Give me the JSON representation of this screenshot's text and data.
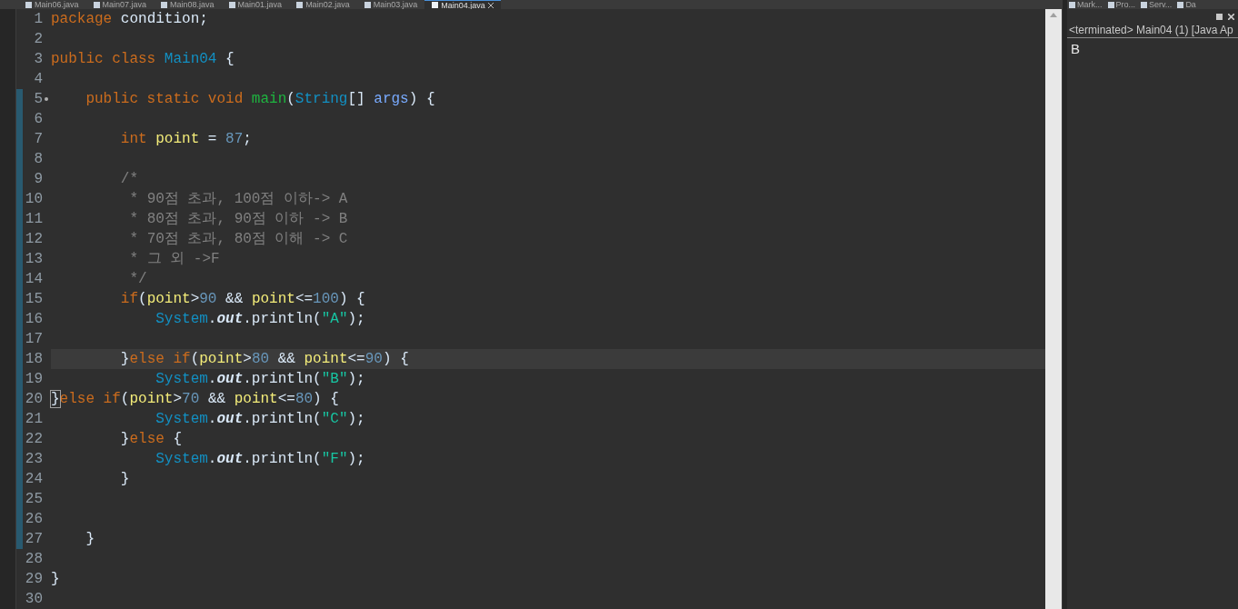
{
  "editor_tabs": [
    {
      "label": "Main06.java",
      "selected": false
    },
    {
      "label": "Main07.java",
      "selected": false
    },
    {
      "label": "Main08.java",
      "selected": false
    },
    {
      "label": "Main01.java",
      "selected": false
    },
    {
      "label": "Main02.java",
      "selected": false
    },
    {
      "label": "Main03.java",
      "selected": false
    },
    {
      "label": "Main04.java",
      "selected": true
    }
  ],
  "lines": [
    {
      "number": "1",
      "scope": false,
      "current": false,
      "fold": false,
      "tokens": [
        {
          "kind": "keyword",
          "text": "package"
        },
        {
          "kind": "plain",
          "text": " condition;"
        }
      ]
    },
    {
      "number": "2",
      "scope": false,
      "current": false,
      "fold": false
    },
    {
      "number": "3",
      "scope": false,
      "current": false,
      "fold": false,
      "tokens": [
        {
          "kind": "keyword",
          "text": "public class"
        },
        {
          "kind": "type",
          "text": " Main04"
        },
        {
          "kind": "plain",
          "text": " {"
        }
      ]
    },
    {
      "number": "4",
      "scope": false,
      "current": false,
      "fold": false
    },
    {
      "number": "5",
      "scope": true,
      "current": false,
      "fold": true,
      "tokens": [
        {
          "kind": "keyword",
          "text": "    public static void"
        },
        {
          "kind": "method",
          "text": " main"
        },
        {
          "kind": "plain",
          "text": "("
        },
        {
          "kind": "type",
          "text": "String"
        },
        {
          "kind": "plain",
          "text": "[]"
        },
        {
          "kind": "param",
          "text": " args"
        },
        {
          "kind": "plain",
          "text": ") {"
        }
      ]
    },
    {
      "number": "6",
      "scope": true,
      "current": false,
      "fold": false
    },
    {
      "number": "7",
      "scope": true,
      "current": false,
      "fold": false,
      "tokens": [
        {
          "kind": "keyword",
          "text": "        int"
        },
        {
          "kind": "local",
          "text": " point"
        },
        {
          "kind": "plain",
          "text": " ="
        },
        {
          "kind": "number",
          "text": " 87"
        },
        {
          "kind": "plain",
          "text": ";"
        }
      ]
    },
    {
      "number": "8",
      "scope": true,
      "current": false,
      "fold": false
    },
    {
      "number": "9",
      "scope": true,
      "current": false,
      "fold": false,
      "tokens": [
        {
          "kind": "comment",
          "text": "        /*"
        }
      ]
    },
    {
      "number": "10",
      "scope": true,
      "current": false,
      "fold": false,
      "tokens": [
        {
          "kind": "comment",
          "text": "         * 90점 초과, 100점 이하-> A"
        }
      ]
    },
    {
      "number": "11",
      "scope": true,
      "current": false,
      "fold": false,
      "tokens": [
        {
          "kind": "comment",
          "text": "         * 80점 초과, 90점 이하 -> B"
        }
      ]
    },
    {
      "number": "12",
      "scope": true,
      "current": false,
      "fold": false,
      "tokens": [
        {
          "kind": "comment",
          "text": "         * 70점 초과, 80점 이해 -> C"
        }
      ]
    },
    {
      "number": "13",
      "scope": true,
      "current": false,
      "fold": false,
      "tokens": [
        {
          "kind": "comment",
          "text": "         * 그 외 ->F"
        }
      ]
    },
    {
      "number": "14",
      "scope": true,
      "current": false,
      "fold": false,
      "tokens": [
        {
          "kind": "comment",
          "text": "         */"
        }
      ]
    },
    {
      "number": "15",
      "scope": true,
      "current": false,
      "fold": false,
      "tokens": [
        {
          "kind": "keyword",
          "text": "        if"
        },
        {
          "kind": "plain",
          "text": "("
        },
        {
          "kind": "local",
          "text": "point"
        },
        {
          "kind": "plain",
          "text": ">"
        },
        {
          "kind": "number",
          "text": "90"
        },
        {
          "kind": "plain",
          "text": " &&"
        },
        {
          "kind": "local",
          "text": " point"
        },
        {
          "kind": "plain",
          "text": "<="
        },
        {
          "kind": "number",
          "text": "100"
        },
        {
          "kind": "plain",
          "text": ") {"
        }
      ]
    },
    {
      "number": "16",
      "scope": true,
      "current": false,
      "fold": false,
      "tokens": [
        {
          "kind": "type",
          "text": "            System"
        },
        {
          "kind": "plain",
          "text": "."
        },
        {
          "kind": "static",
          "text": "out"
        },
        {
          "kind": "plain",
          "text": ".println("
        },
        {
          "kind": "string",
          "text": "\"A\""
        },
        {
          "kind": "plain",
          "text": ");"
        }
      ]
    },
    {
      "number": "17",
      "scope": true,
      "current": false,
      "fold": false
    },
    {
      "number": "18",
      "scope": true,
      "current": true,
      "fold": false,
      "tokens": [
        {
          "kind": "plain",
          "text": "        }"
        },
        {
          "kind": "keyword",
          "text": "else if"
        },
        {
          "kind": "plain",
          "text": "("
        },
        {
          "kind": "local",
          "text": "point"
        },
        {
          "kind": "plain",
          "text": ">"
        },
        {
          "kind": "number",
          "text": "80"
        },
        {
          "kind": "plain",
          "text": " &&"
        },
        {
          "kind": "local",
          "text": " point"
        },
        {
          "kind": "plain",
          "text": "<="
        },
        {
          "kind": "number",
          "text": "90"
        },
        {
          "kind": "plain",
          "text": ") {"
        }
      ]
    },
    {
      "number": "19",
      "scope": true,
      "current": false,
      "fold": false,
      "tokens": [
        {
          "kind": "type",
          "text": "            System"
        },
        {
          "kind": "plain",
          "text": "."
        },
        {
          "kind": "static",
          "text": "out"
        },
        {
          "kind": "plain",
          "text": ".println("
        },
        {
          "kind": "string",
          "text": "\"B\""
        },
        {
          "kind": "plain",
          "text": ");"
        }
      ]
    },
    {
      "number": "20",
      "scope": true,
      "current": false,
      "fold": false,
      "tokens": [
        {
          "kind": "bracket_match",
          "text": "}"
        },
        {
          "kind": "keyword",
          "text": "else if"
        },
        {
          "kind": "plain",
          "text": "("
        },
        {
          "kind": "local",
          "text": "point"
        },
        {
          "kind": "plain",
          "text": ">"
        },
        {
          "kind": "number",
          "text": "70"
        },
        {
          "kind": "plain",
          "text": " &&"
        },
        {
          "kind": "local",
          "text": " point"
        },
        {
          "kind": "plain",
          "text": "<="
        },
        {
          "kind": "number",
          "text": "80"
        },
        {
          "kind": "plain",
          "text": ") {"
        }
      ]
    },
    {
      "number": "21",
      "scope": true,
      "current": false,
      "fold": false,
      "tokens": [
        {
          "kind": "type",
          "text": "            System"
        },
        {
          "kind": "plain",
          "text": "."
        },
        {
          "kind": "static",
          "text": "out"
        },
        {
          "kind": "plain",
          "text": ".println("
        },
        {
          "kind": "string",
          "text": "\"C\""
        },
        {
          "kind": "plain",
          "text": ");"
        }
      ]
    },
    {
      "number": "22",
      "scope": true,
      "current": false,
      "fold": false,
      "tokens": [
        {
          "kind": "plain",
          "text": "        }"
        },
        {
          "kind": "keyword",
          "text": "else"
        },
        {
          "kind": "plain",
          "text": " {"
        }
      ]
    },
    {
      "number": "23",
      "scope": true,
      "current": false,
      "fold": false,
      "tokens": [
        {
          "kind": "type",
          "text": "            System"
        },
        {
          "kind": "plain",
          "text": "."
        },
        {
          "kind": "static",
          "text": "out"
        },
        {
          "kind": "plain",
          "text": ".println("
        },
        {
          "kind": "string",
          "text": "\"F\""
        },
        {
          "kind": "plain",
          "text": ");"
        }
      ]
    },
    {
      "number": "24",
      "scope": true,
      "current": false,
      "fold": false,
      "tokens": [
        {
          "kind": "plain",
          "text": "        }"
        }
      ]
    },
    {
      "number": "25",
      "scope": true,
      "current": false,
      "fold": false
    },
    {
      "number": "26",
      "scope": true,
      "current": false,
      "fold": false
    },
    {
      "number": "27",
      "scope": true,
      "current": false,
      "fold": false,
      "tokens": [
        {
          "kind": "plain",
          "text": "    }"
        }
      ]
    },
    {
      "number": "28",
      "scope": false,
      "current": false,
      "fold": false
    },
    {
      "number": "29",
      "scope": false,
      "current": false,
      "fold": false,
      "tokens": [
        {
          "kind": "plain",
          "text": "}"
        }
      ]
    },
    {
      "number": "30",
      "scope": false,
      "current": false,
      "fold": false
    }
  ],
  "view_tabs": [
    {
      "label": "Mark..."
    },
    {
      "label": "Pro..."
    },
    {
      "label": "Serv..."
    },
    {
      "label": "Da"
    }
  ],
  "console": {
    "status": "<terminated> Main04 (1) [Java Ap",
    "output": "B"
  }
}
